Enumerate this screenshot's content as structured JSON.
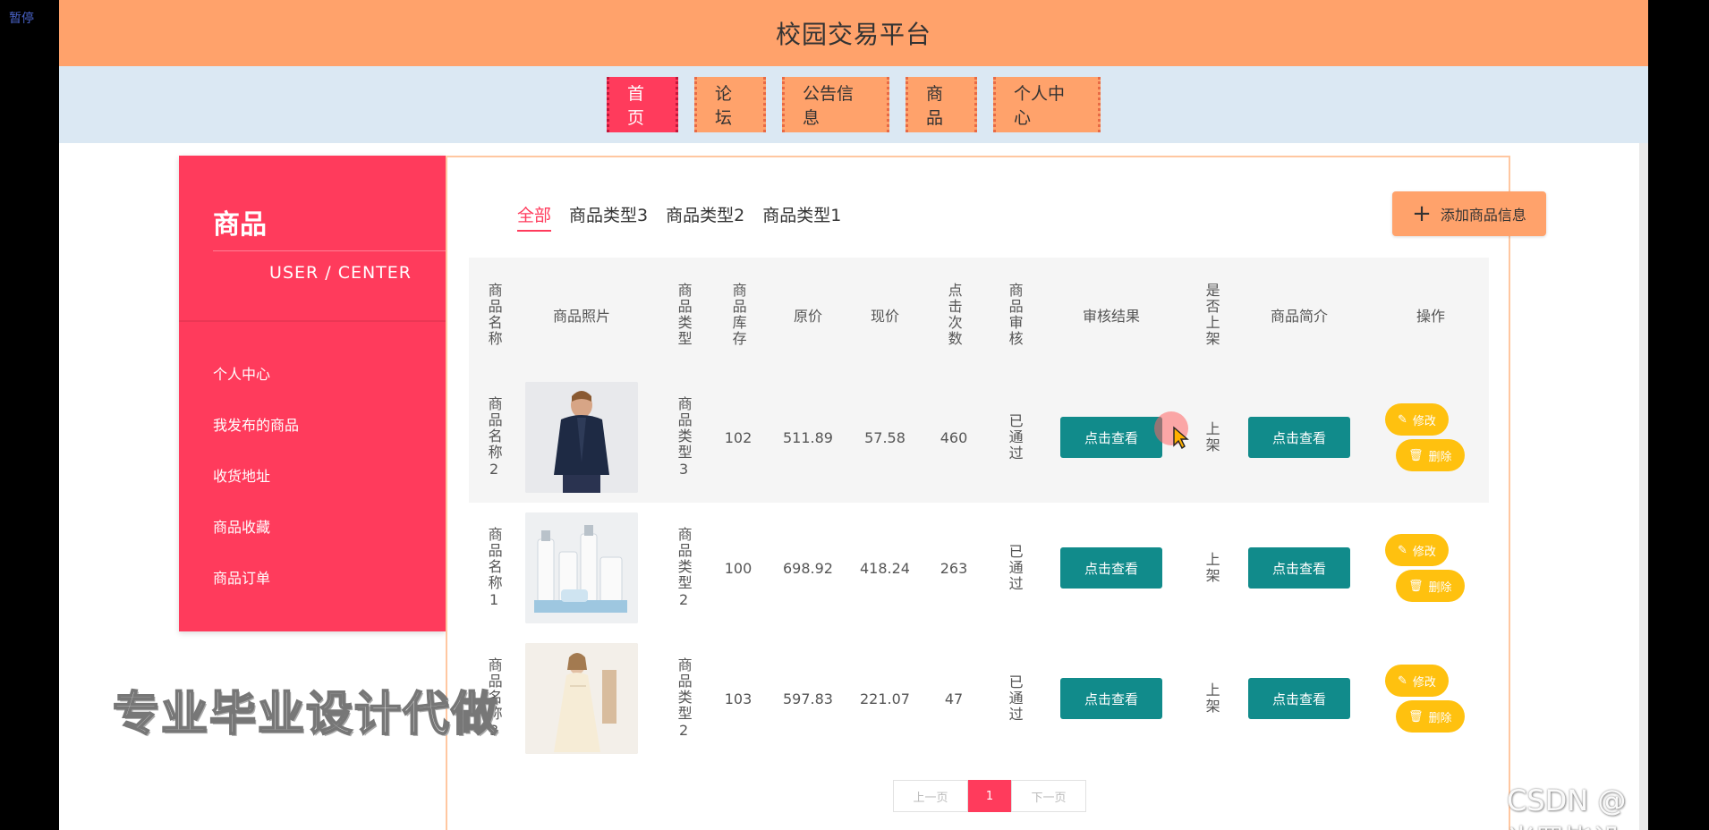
{
  "overlay": {
    "pause_label": "暂停"
  },
  "header": {
    "title": "校园交易平台"
  },
  "nav": {
    "items": [
      "首页",
      "论坛",
      "公告信息",
      "商品",
      "个人中心"
    ]
  },
  "sidebar": {
    "title": "商品",
    "subtitle": "USER / CENTER",
    "items": [
      "个人中心",
      "我发布的商品",
      "收货地址",
      "商品收藏",
      "商品订单"
    ]
  },
  "tabs": [
    "全部",
    "商品类型3",
    "商品类型2",
    "商品类型1"
  ],
  "add_button": "添加商品信息",
  "table": {
    "headers": [
      "商品名称",
      "商品照片",
      "商品类型",
      "商品库存",
      "原价",
      "现价",
      "点击次数",
      "商品审核",
      "审核结果",
      "是否上架",
      "商品简介",
      "操作"
    ],
    "rows": [
      {
        "name": "商品名称2",
        "type": "商品类型3",
        "stock": "102",
        "orig": "511.89",
        "price": "57.58",
        "clicks": "460",
        "review": "已通过",
        "result_btn": "点击查看",
        "shelf": "上架",
        "desc_btn": "点击查看",
        "edit": "修改",
        "del": "删除"
      },
      {
        "name": "商品名称1",
        "type": "商品类型2",
        "stock": "100",
        "orig": "698.92",
        "price": "418.24",
        "clicks": "263",
        "review": "已通过",
        "result_btn": "点击查看",
        "shelf": "上架",
        "desc_btn": "点击查看",
        "edit": "修改",
        "del": "删除"
      },
      {
        "name": "商品名称3",
        "type": "商品类型2",
        "stock": "103",
        "orig": "597.83",
        "price": "221.07",
        "clicks": "47",
        "review": "已通过",
        "result_btn": "点击查看",
        "shelf": "上架",
        "desc_btn": "点击查看",
        "edit": "修改",
        "del": "删除"
      }
    ]
  },
  "pager": {
    "prev": "上一页",
    "current": "1",
    "next": "下一页"
  },
  "watermarks": {
    "left": "专业毕业设计代做",
    "right": "CSDN @米罗毕设"
  },
  "colors": {
    "header": "#ffa26b",
    "accent": "#ff3b5c",
    "teal": "#118b8b",
    "yellow": "#ffc10f"
  }
}
